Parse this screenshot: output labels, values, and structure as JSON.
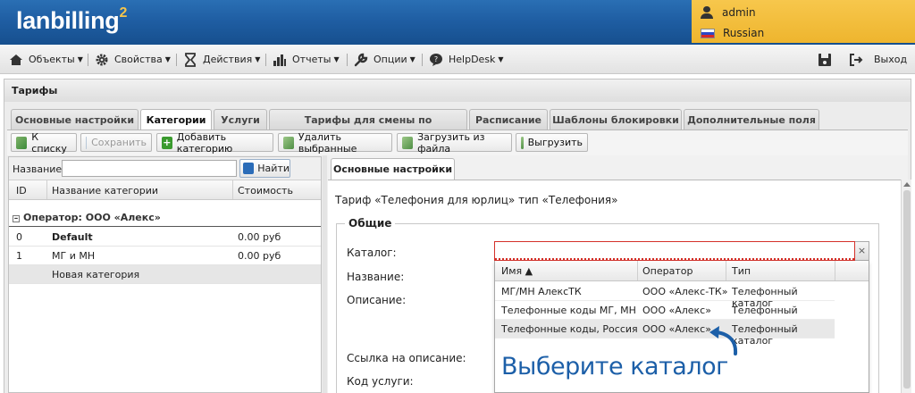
{
  "header": {
    "logo_text": "lanbilling",
    "logo_sup": "2",
    "user": "admin",
    "language": "Russian"
  },
  "menu": {
    "items": [
      {
        "label": "Объекты",
        "icon": "objects-icon"
      },
      {
        "label": "Свойства",
        "icon": "gear-icon"
      },
      {
        "label": "Действия",
        "icon": "hourglass-icon"
      },
      {
        "label": "Отчеты",
        "icon": "bar-chart-icon"
      },
      {
        "label": "Опции",
        "icon": "wrench-icon"
      },
      {
        "label": "HelpDesk",
        "icon": "chat-icon"
      }
    ],
    "logout_label": "Выход"
  },
  "panel": {
    "title": "Тарифы",
    "tabs": [
      "Основные настройки",
      "Категории",
      "Услуги",
      "Тарифы для смены по расписанию",
      "Расписание",
      "Шаблоны блокировки",
      "Дополнительные поля"
    ],
    "active_tab": "Категории"
  },
  "toolbar": {
    "to_list": "К списку",
    "save": "Сохранить",
    "add_category": "Добавить категорию",
    "delete_selected": "Удалить выбранные",
    "load_from_file": "Загрузить из файла",
    "export": "Выгрузить"
  },
  "left_grid": {
    "search_label": "Название:",
    "search_value": "",
    "find_button": "Найти",
    "columns": [
      "ID",
      "Название категории",
      "Стоимость"
    ],
    "group_label": "Оператор: ООО «Алекс»",
    "rows": [
      {
        "id": "0",
        "name": "Default",
        "cost": "0.00 руб"
      },
      {
        "id": "1",
        "name": "МГ и МН",
        "cost": "0.00 руб"
      }
    ],
    "new_row_label": "Новая категория"
  },
  "right_panel": {
    "tab": "Основные настройки",
    "description": "Тариф «Телефония для юрлиц» тип «Телефония»",
    "fieldset_legend": "Общие",
    "labels": {
      "catalog": "Каталог:",
      "name": "Название:",
      "description": "Описание:",
      "desc_link": "Ссылка на описание:",
      "service_code": "Код услуги:"
    },
    "catalog_value": "",
    "clear_button": "×",
    "dropdown": {
      "columns": [
        "Имя ▲",
        "Оператор",
        "Тип"
      ],
      "rows": [
        {
          "name": "МГ/МН АлексТК",
          "operator": "ООО «Алекс-ТК»",
          "type": "Телефонный каталог"
        },
        {
          "name": "Телефонные коды МГ, МН",
          "operator": "ООО «Алекс»",
          "type": "Телефонный каталог"
        },
        {
          "name": "Телефонные коды, Россия",
          "operator": "ООО «Алекс»",
          "type": "Телефонный каталог"
        }
      ]
    },
    "hint": "Выберите каталог"
  },
  "colors": {
    "header_blue": "#1f5ea3",
    "user_box": "#f2bb36",
    "hint_blue": "#1c5fa8",
    "error_red": "#d4312a"
  }
}
